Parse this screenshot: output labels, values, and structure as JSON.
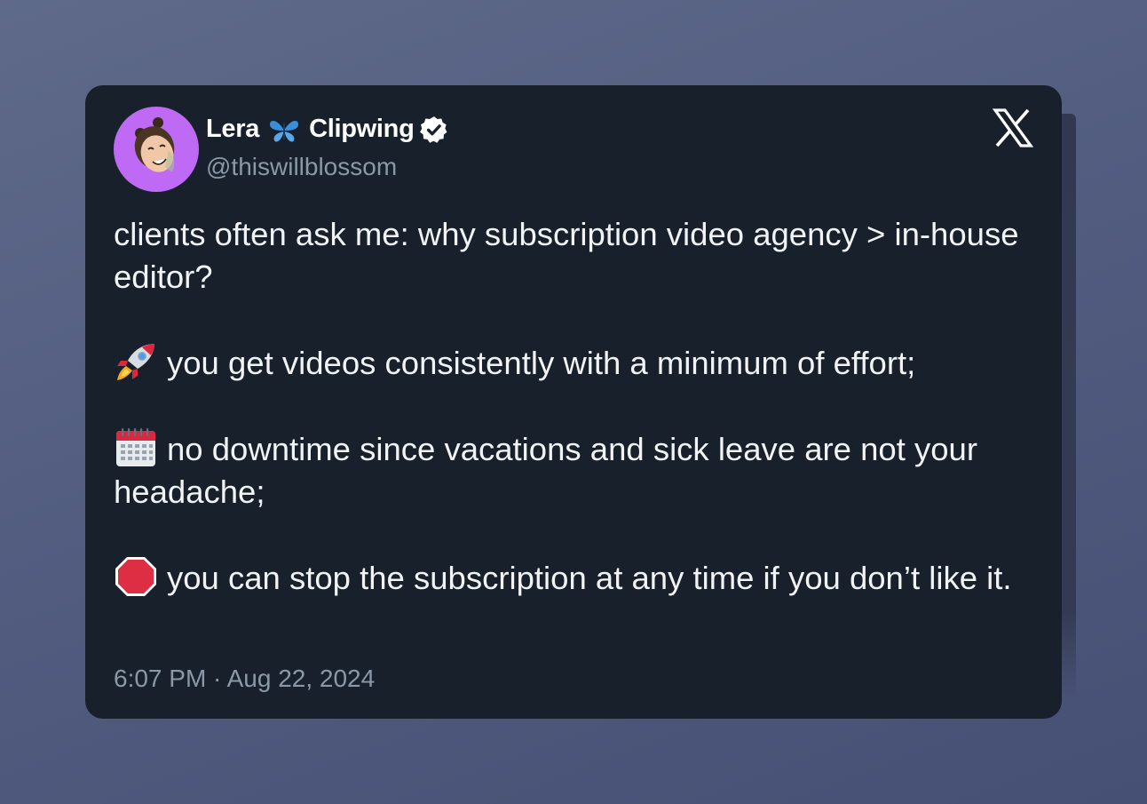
{
  "tweet": {
    "author": {
      "name_first": "Lera",
      "name_last": "Clipwing",
      "handle": "@thiswillblossom",
      "verified": true,
      "avatar_color": "#bf6af4"
    },
    "paragraphs": [
      {
        "emoji": "",
        "text": "clients often ask me: why subscription video agency > in-house editor?"
      },
      {
        "emoji": "rocket-icon",
        "text": "you get videos consistently with a minimum of effort;"
      },
      {
        "emoji": "calendar-icon",
        "text": "no downtime since vacations and sick leave are not your headache;"
      },
      {
        "emoji": "stop-sign-icon",
        "text": "you can stop the subscription at any time if you don’t like it."
      }
    ],
    "timestamp": "6:07 PM · Aug 22, 2024",
    "platform_logo": "x-logo-icon"
  },
  "colors": {
    "background": "#566183",
    "card": "#17202b",
    "text": "#f1f3f5",
    "muted": "#8b98a5",
    "accent_avatar": "#bf6af4"
  }
}
